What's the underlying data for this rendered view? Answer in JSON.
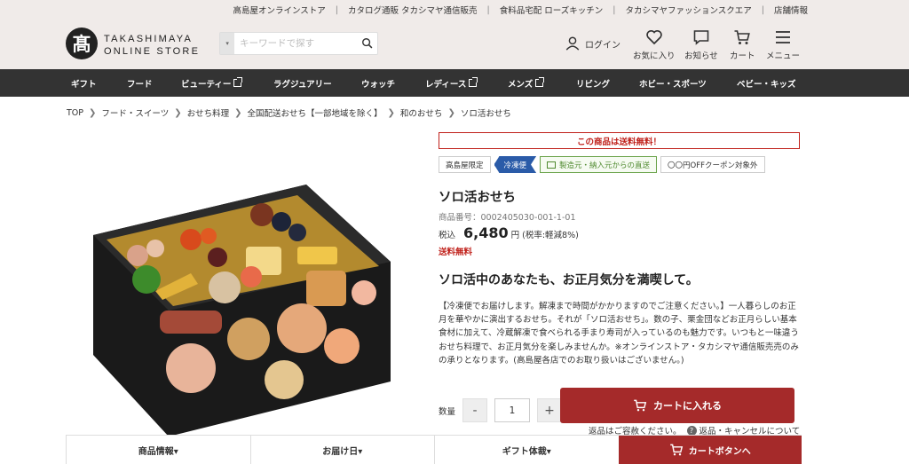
{
  "top_links": [
    "高島屋オンラインストア",
    "カタログ通販 タカシマヤ通信販売",
    "食料品宅配 ローズキッチン",
    "タカシマヤファッションスクエア",
    "店舗情報"
  ],
  "logo": {
    "mark": "髙",
    "line1": "TAKASHIMAYA",
    "line2": "ONLINE STORE"
  },
  "search": {
    "placeholder": "キーワードで探す",
    "category_glyph": "▾"
  },
  "header": {
    "login": "ログイン",
    "favorites": "お気に入り",
    "notices": "お知らせ",
    "cart": "カート",
    "menu": "メニュー"
  },
  "nav": [
    {
      "label": "ギフト",
      "external": false
    },
    {
      "label": "フード",
      "external": false
    },
    {
      "label": "ビューティー",
      "external": true
    },
    {
      "label": "ラグジュアリー",
      "external": false
    },
    {
      "label": "ウォッチ",
      "external": false
    },
    {
      "label": "レディース",
      "external": true
    },
    {
      "label": "メンズ",
      "external": true
    },
    {
      "label": "リビング",
      "external": false
    },
    {
      "label": "ホビー・スポーツ",
      "external": false
    },
    {
      "label": "ベビー・キッズ",
      "external": false
    }
  ],
  "breadcrumb": [
    "TOP",
    "フード・スイーツ",
    "おせち料理",
    "全国配送おせち【一部地域を除く】",
    "和のおせち",
    "ソロ活おせち"
  ],
  "product": {
    "free_shipping_banner": "この商品は送料無料！",
    "tags": {
      "exclusive": "高島屋限定",
      "frozen": "冷凍便",
      "direct": "製造元・納入元からの直送",
      "coupon": "〇〇円OFFクーポン対象外"
    },
    "title": "ソロ活おせち",
    "sku": "商品番号：0002405030-001-1-01",
    "price_label": "税込",
    "price": "6,480",
    "price_unit": "円",
    "tax_note": "(税率:軽減8%)",
    "shipping": "送料無料",
    "catch": "ソロ活中のあなたも、お正月気分を満喫して。",
    "description": "【冷凍便でお届けします。解凍まで時間がかかりますのでご注意ください。】一人暮らしのお正月を華やかに演出するおせち。それが「ソロ活おせち」。数の子、栗金団などお正月らしい基本食材に加えて、冷蔵解凍で食べられる手まり寿司が入っているのも魅力です。いつもと一味違うおせち料理で、お正月気分を楽しみませんか。※オンラインストア・タカシマヤ通信販売売のみの承りとなります。(高島屋各店でのお取り扱いはございません。)"
  },
  "purchase": {
    "qty_label": "数量",
    "qty": "1",
    "minus": "-",
    "plus": "+",
    "add_to_cart": "カートに入れる",
    "returns_text": "返品はご容赦ください。",
    "returns_link": "返品・キャンセルについて"
  },
  "bottom_tabs": {
    "info": "商品情報▾",
    "delivery": "お届け日▾",
    "gift": "ギフト体裁▾",
    "cart": "カートボタンへ"
  }
}
